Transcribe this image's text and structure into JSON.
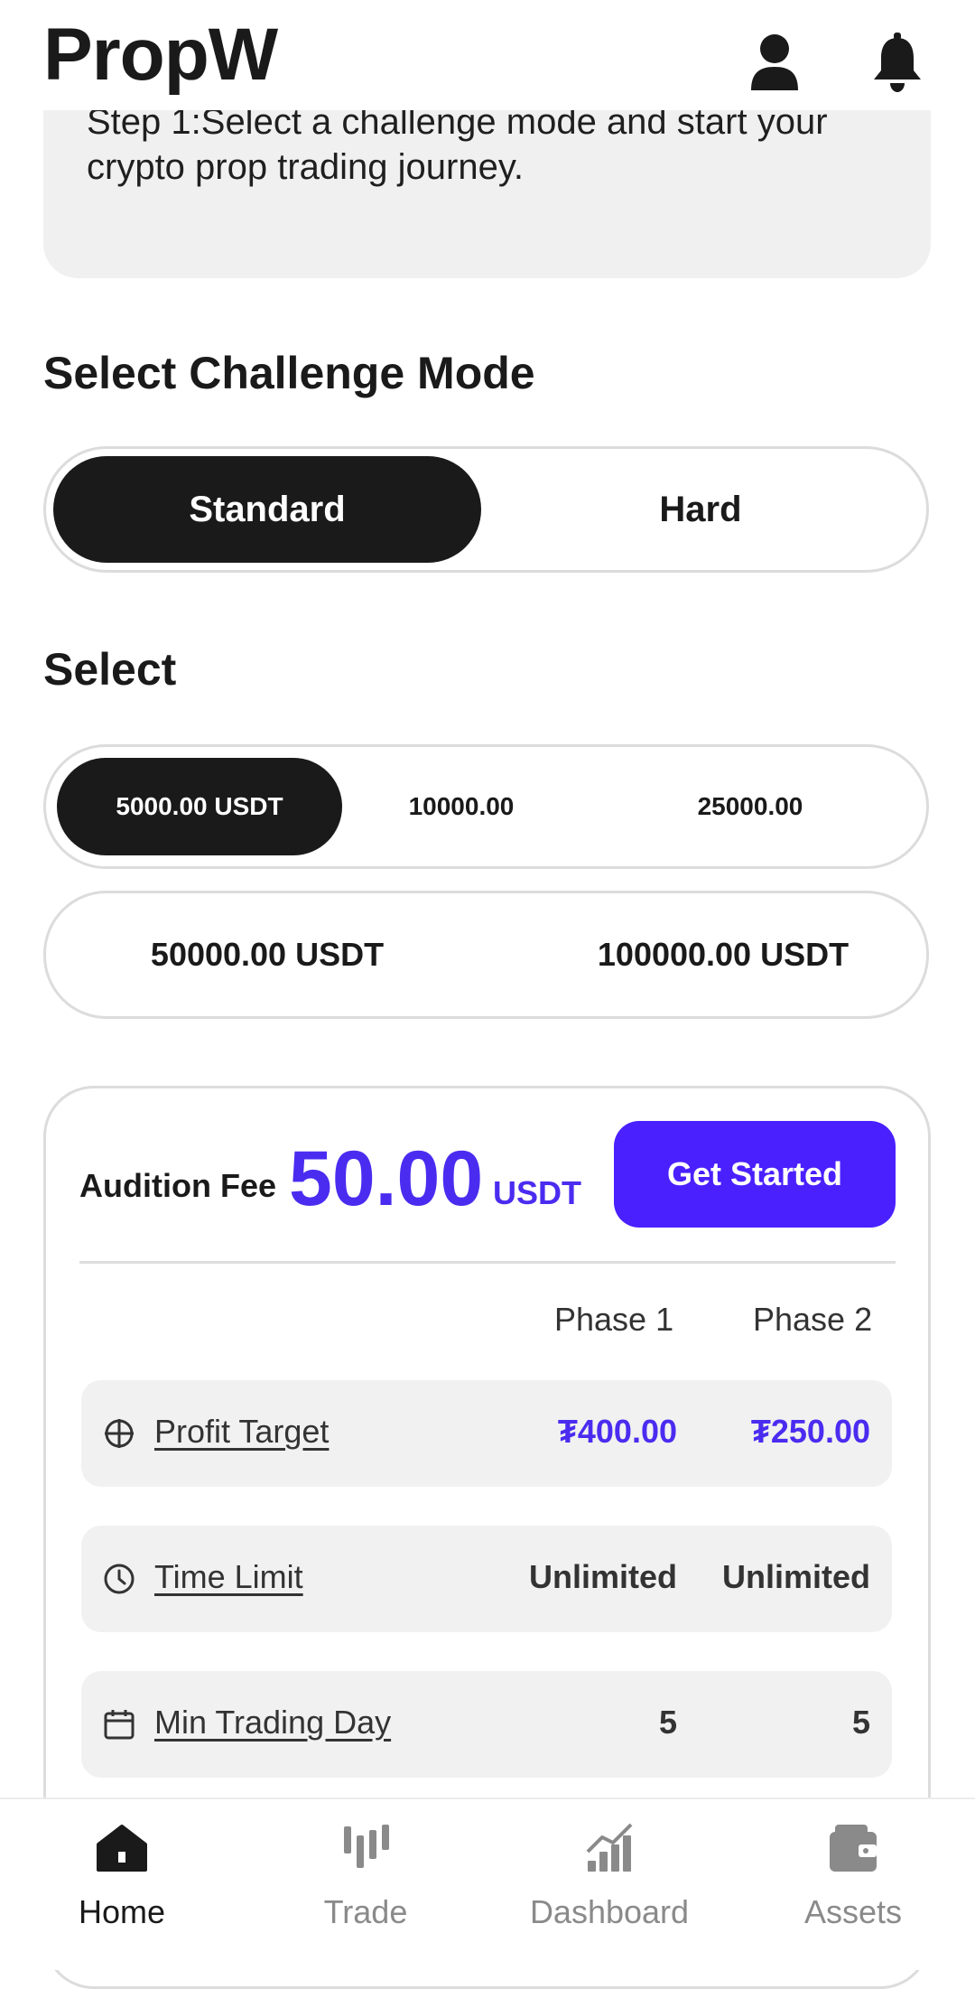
{
  "app": {
    "title": "PropW"
  },
  "info": {
    "text": "Step 1:Select a challenge mode and start your crypto prop trading journey."
  },
  "mode": {
    "title": "Select Challenge Mode",
    "options": [
      "Standard",
      "Hard"
    ],
    "selected": "Standard"
  },
  "amounts": {
    "title": "Select",
    "row1": [
      "5000.00 USDT",
      "10000.00",
      "25000.00"
    ],
    "row2": [
      "50000.00 USDT",
      "100000.00 USDT"
    ],
    "selected": "5000.00 USDT"
  },
  "fee": {
    "label": "Audition Fee",
    "amount": "50.00",
    "unit": "USDT",
    "cta": "Get Started"
  },
  "phases": [
    "Phase 1",
    "Phase 2"
  ],
  "rules": [
    {
      "icon": "target-icon",
      "label": "Profit Target",
      "phase1": "₮400.00",
      "phase2": "₮250.00"
    },
    {
      "icon": "clock-icon",
      "label": "Time Limit",
      "phase1": "Unlimited",
      "phase2": "Unlimited"
    },
    {
      "icon": "calendar-icon",
      "label": "Min Trading Day",
      "phase1": "5",
      "phase2": "5"
    }
  ],
  "nav": [
    {
      "label": "Home",
      "icon": "home-icon",
      "active": true
    },
    {
      "label": "Trade",
      "icon": "candlestick-icon",
      "active": false
    },
    {
      "label": "Dashboard",
      "icon": "chart-icon",
      "active": false
    },
    {
      "label": "Assets",
      "icon": "wallet-icon",
      "active": false
    }
  ],
  "colors": {
    "accent": "#4a20ff",
    "accent_text": "#4a2cf0",
    "dark": "#1a1a1a",
    "card_bg": "#f0f0f0"
  }
}
